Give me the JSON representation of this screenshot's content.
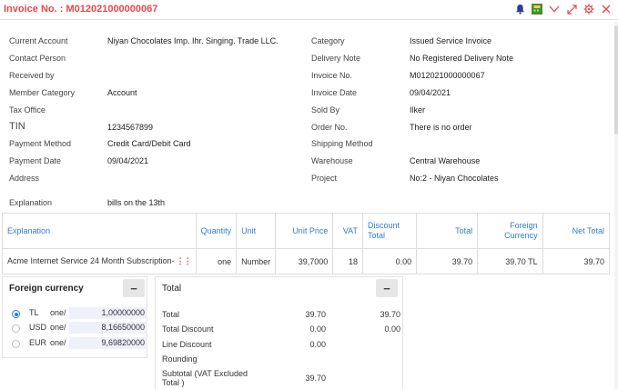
{
  "header": {
    "title": "Invoice No. : M012021000000067",
    "icons": [
      "bell-icon",
      "calculator-icon",
      "chevron-down-icon",
      "expand-icon",
      "gear-icon",
      "close-icon"
    ]
  },
  "info_left": [
    {
      "label": "Current Account",
      "value": "Niyan Chocolates Imp. Ihr. Singing. Trade LLC."
    },
    {
      "label": "Contact Person",
      "value": ""
    },
    {
      "label": "Received by",
      "value": ""
    },
    {
      "label": "Member Category",
      "value": "Account"
    },
    {
      "label": "Tax Office",
      "value": ""
    },
    {
      "label": "TIN",
      "value": "1234567899"
    },
    {
      "label": "Payment Method",
      "value": "Credit Card/Debit Card"
    },
    {
      "label": "Payment Date",
      "value": "09/04/2021"
    },
    {
      "label": "Address",
      "value": ""
    }
  ],
  "info_right": [
    {
      "label": "Category",
      "value": "Issued Service Invoice"
    },
    {
      "label": "Delivery Note",
      "value": "No Registered Delivery Note"
    },
    {
      "label": "Invoice No.",
      "value": "M012021000000067"
    },
    {
      "label": "Invoice Date",
      "value": "09/04/2021"
    },
    {
      "label": "Sold By",
      "value": "Ilker"
    },
    {
      "label": "Order No.",
      "value": "There is no order"
    },
    {
      "label": "Shipping Method",
      "value": ""
    },
    {
      "label": "Warehouse",
      "value": "Central Warehouse"
    },
    {
      "label": "Project",
      "value": "No:2 - Niyan Chocolates"
    }
  ],
  "explanation": {
    "label": "Explanation",
    "value": "bills on the 13th"
  },
  "items_table": {
    "headers": [
      "Explanation",
      "Quantity",
      "Unit",
      "Unit Price",
      "VAT",
      "Discount Total",
      "Total",
      "Foreign Currency",
      "Net Total"
    ],
    "rows": [
      {
        "explanation": "Acme Internet Service 24 Month Subscription-",
        "quantity": "one",
        "unit": "Number",
        "unit_price": "39,7000",
        "vat": "18",
        "discount_total": "0.00",
        "total": "39.70",
        "foreign_currency": "39.70 TL",
        "net_total": "39.70"
      }
    ]
  },
  "foreign_currency": {
    "title": "Foreign currency",
    "collapse": "−",
    "rates": [
      {
        "code": "TL",
        "per": "one/",
        "rate": "1,00000000",
        "selected": true
      },
      {
        "code": "USD",
        "per": "one/",
        "rate": "8,16650000",
        "selected": false
      },
      {
        "code": "EUR",
        "per": "one/",
        "rate": "9,69820000",
        "selected": false
      }
    ]
  },
  "totals": {
    "title": "Total",
    "collapse": "−",
    "rows": [
      {
        "label": "Total",
        "v1": "39.70",
        "v2": "39.70"
      },
      {
        "label": "Total Discount",
        "v1": "0.00",
        "v2": "0.00"
      },
      {
        "label": "Line Discount",
        "v1": "0.00",
        "v2": ""
      },
      {
        "label": "Rounding",
        "v1": "",
        "v2": ""
      },
      {
        "label": "Subtotal (VAT Excluded Total )",
        "v1": "39.70",
        "v2": ""
      }
    ]
  },
  "colors": {
    "accent": "#e8474c",
    "link": "#2f7fd6"
  }
}
